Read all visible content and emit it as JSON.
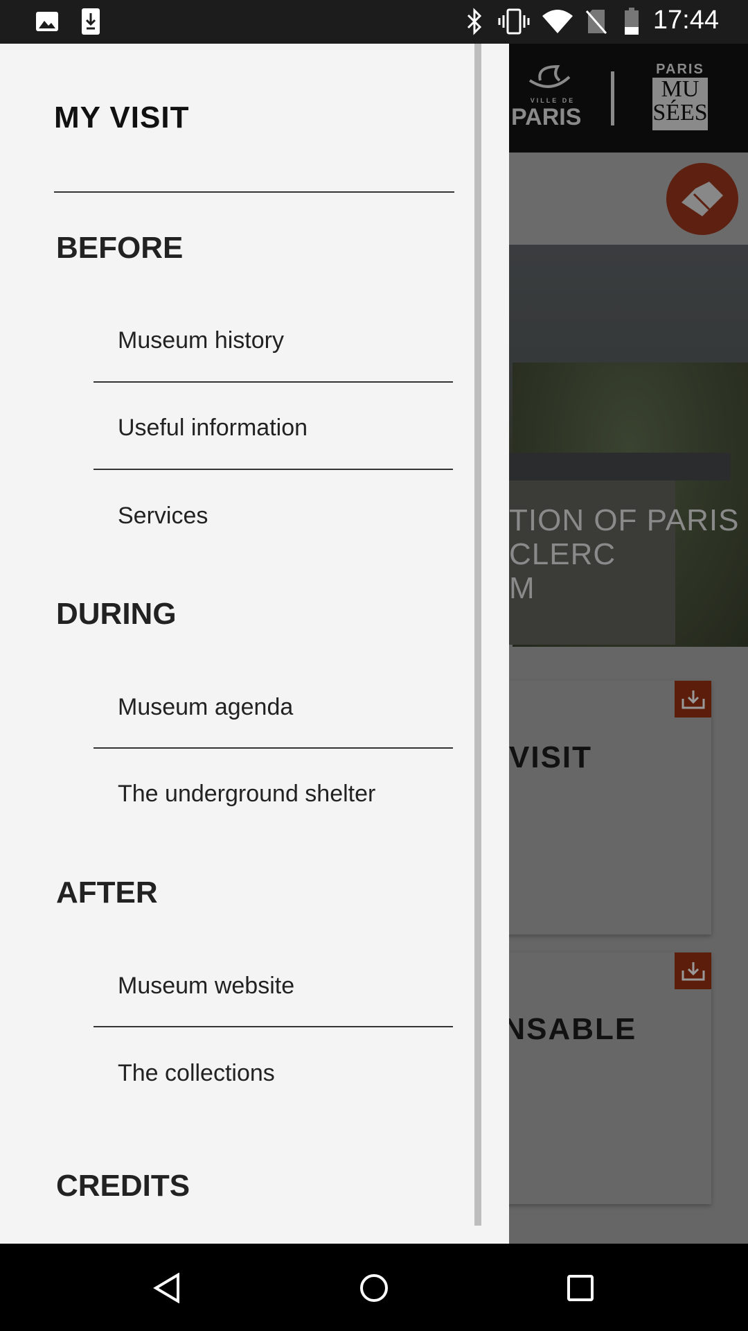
{
  "status_bar": {
    "time": "17:44",
    "icons": [
      "image-icon",
      "download-icon",
      "bluetooth-icon",
      "vibrate-icon",
      "wifi-icon",
      "no-sim-icon",
      "battery-icon"
    ]
  },
  "background": {
    "logo_ville": "VILLE DE PARIS",
    "logo_musees": "PARIS MUSÉES",
    "hero_lines": [
      "TION OF PARIS",
      "CLERC",
      "M"
    ],
    "cards": [
      {
        "title": "VISIT"
      },
      {
        "title": "ENSABLE"
      }
    ],
    "accent": "#c1461f"
  },
  "drawer": {
    "title": "MY VISIT",
    "sections": [
      {
        "label": "BEFORE",
        "items": [
          "Museum history",
          "Useful information",
          "Services"
        ]
      },
      {
        "label": "DURING",
        "items": [
          "Museum agenda",
          "The underground shelter"
        ]
      },
      {
        "label": "AFTER",
        "items": [
          "Museum website",
          "The collections"
        ]
      },
      {
        "label": "CREDITS",
        "items": []
      }
    ]
  },
  "nav_bar": {
    "icons": [
      "back-icon",
      "home-icon",
      "recents-icon"
    ]
  }
}
